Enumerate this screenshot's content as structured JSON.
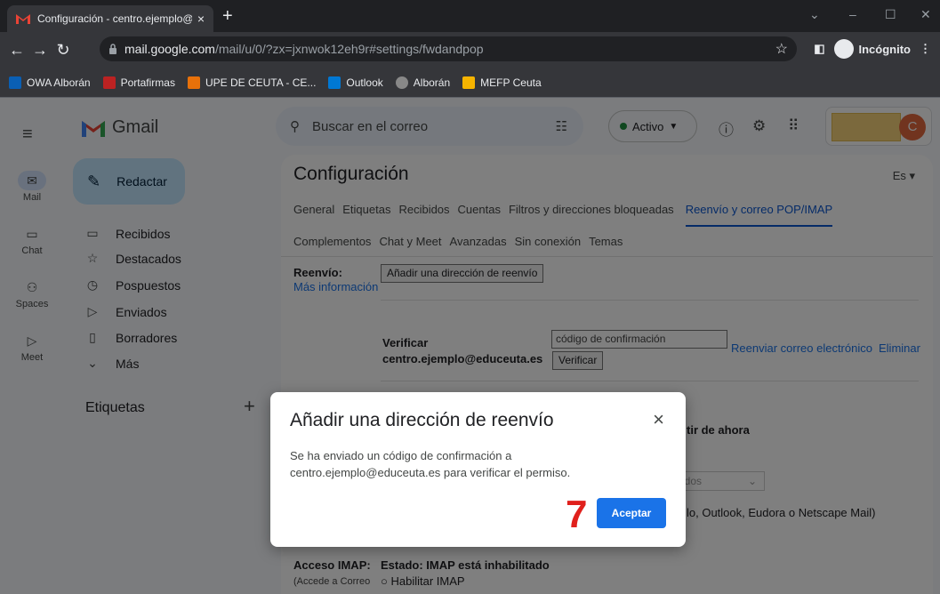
{
  "browser": {
    "tab_title": "Configuración - centro.ejemplo@",
    "tab_close": "×",
    "new_tab": "+",
    "url_host": "mail.google.com",
    "url_path": "/mail/u/0/?zx=jxnwok12eh9r#settings/fwdandpop",
    "incognito_label": "Incógnito",
    "bookmarks": [
      "OWA Alborán",
      "Portafirmas",
      "UPE DE CEUTA - CE...",
      "Outlook",
      "Alborán",
      "MEFP Ceuta"
    ]
  },
  "rail": [
    {
      "label": "Mail",
      "icon": "mail-icon"
    },
    {
      "label": "Chat",
      "icon": "chat-icon"
    },
    {
      "label": "Spaces",
      "icon": "spaces-icon"
    },
    {
      "label": "Meet",
      "icon": "meet-icon"
    }
  ],
  "gmail": {
    "logo_text": "Gmail",
    "compose_label": "Redactar",
    "folders": [
      "Recibidos",
      "Destacados",
      "Pospuestos",
      "Enviados",
      "Borradores",
      "Más"
    ],
    "labels_header": "Etiquetas",
    "labels_add": "+",
    "search_placeholder": "Buscar en el correo",
    "status_label": "Activo",
    "avatar_letter": "C"
  },
  "settings": {
    "title": "Configuración",
    "lang": "Es",
    "tabs_row1": [
      "General",
      "Etiquetas",
      "Recibidos",
      "Cuentas",
      "Filtros y direcciones bloqueadas",
      "Reenvío y correo POP/IMAP"
    ],
    "tabs_row2": [
      "Complementos",
      "Chat y Meet",
      "Avanzadas",
      "Sin conexión",
      "Temas"
    ],
    "forward_label": "Reenvío:",
    "more_info": "Más información",
    "add_forward_button": "Añadir una dirección de reenvío",
    "verify_label": "Verificar",
    "verify_email": "centro.ejemplo@educeuta.es",
    "code_placeholder": "código de confirmación",
    "verify_button": "Verificar",
    "resend_link": "Reenviar correo electrónico",
    "delete_link": "Eliminar",
    "partial_from_now": "tir de ahora",
    "partial_select": "idos",
    "partial_clients": "lo, Outlook, Eudora o Netscape Mail)",
    "imap_label": "Acceso IMAP:",
    "imap_status": "Estado: IMAP está inhabilitado",
    "imap_access_note": "(Accede a Correo",
    "imap_enable": "Habilitar IMAP"
  },
  "dialog": {
    "title": "Añadir una dirección de reenvío",
    "close": "×",
    "body": "Se ha enviado un código de confirmación a centro.ejemplo@educeuta.es para verificar el permiso.",
    "step_number": "7",
    "accept_button": "Aceptar"
  }
}
